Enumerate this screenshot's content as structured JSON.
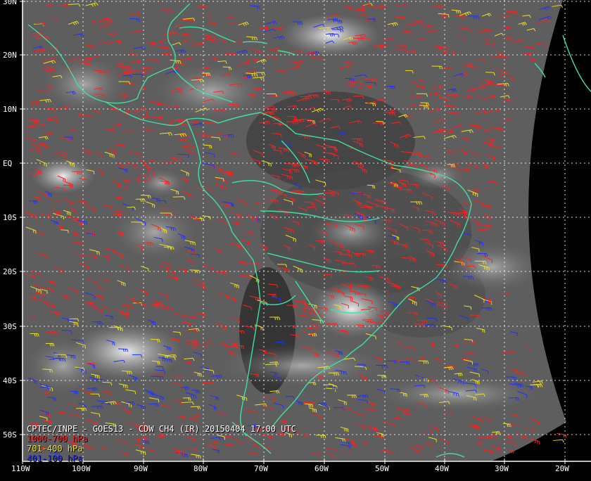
{
  "product": {
    "caption": "CPTEC/INPE - GOES13 - CDW CH4 (IR) 20150404 17:00 UTC"
  },
  "legend": [
    {
      "text": "1000-700 hPa",
      "color": "#ff2020"
    },
    {
      "text": "701-400 hPa",
      "color": "#f0e020"
    },
    {
      "text": "401-100 hPa",
      "color": "#2030ff"
    }
  ],
  "axes": {
    "lat_labels": [
      "30N",
      "20N",
      "10N",
      "EQ",
      "10S",
      "20S",
      "30S",
      "40S",
      "50S"
    ],
    "lon_labels": [
      "110W",
      "100W",
      "90W",
      "80W",
      "70W",
      "60W",
      "50W",
      "40W",
      "30W",
      "20W"
    ]
  },
  "colors": {
    "coastline": "#40e0a0",
    "grid": "#ffffff",
    "frame": "#ffffff",
    "background": "#000000"
  }
}
